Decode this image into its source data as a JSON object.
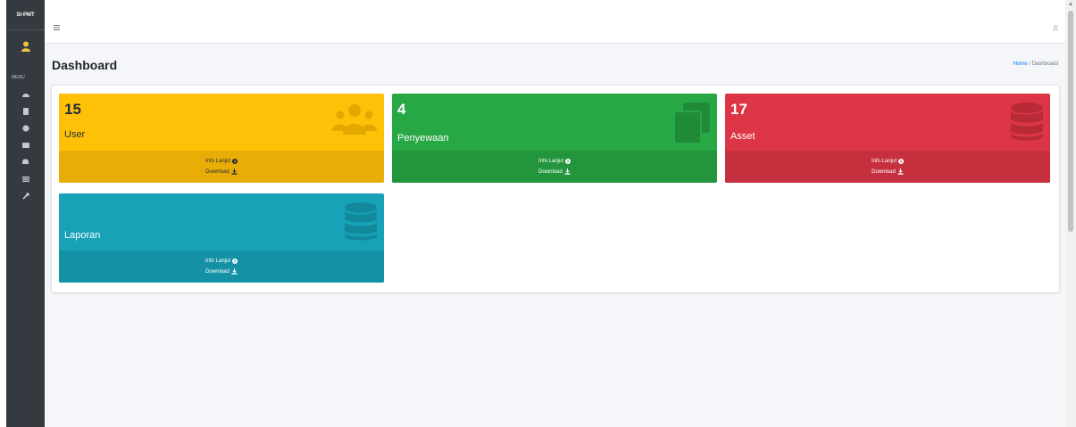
{
  "sidebar": {
    "brand": "SI-PMT",
    "menu_header": "MENU"
  },
  "header": {
    "title": "Dashboard",
    "breadcrumb": {
      "home": "Home",
      "separator": "/",
      "current": "Dashboard"
    }
  },
  "boxes": [
    {
      "number": "15",
      "label": "User",
      "info": "Info Lanjut",
      "download": "Download"
    },
    {
      "number": "4",
      "label": "Penyewaan",
      "info": "Info Lanjut",
      "download": "Download"
    },
    {
      "number": "17",
      "label": "Asset",
      "info": "Info Lanjut",
      "download": "Download"
    },
    {
      "number": "",
      "label": "Laporan",
      "info": "Info Lanjut",
      "download": "Download"
    }
  ],
  "colors": {
    "sidebar": "#343a40",
    "yellow": "#ffc107",
    "green": "#28a745",
    "red": "#dc3545",
    "teal": "#17a2b8"
  }
}
